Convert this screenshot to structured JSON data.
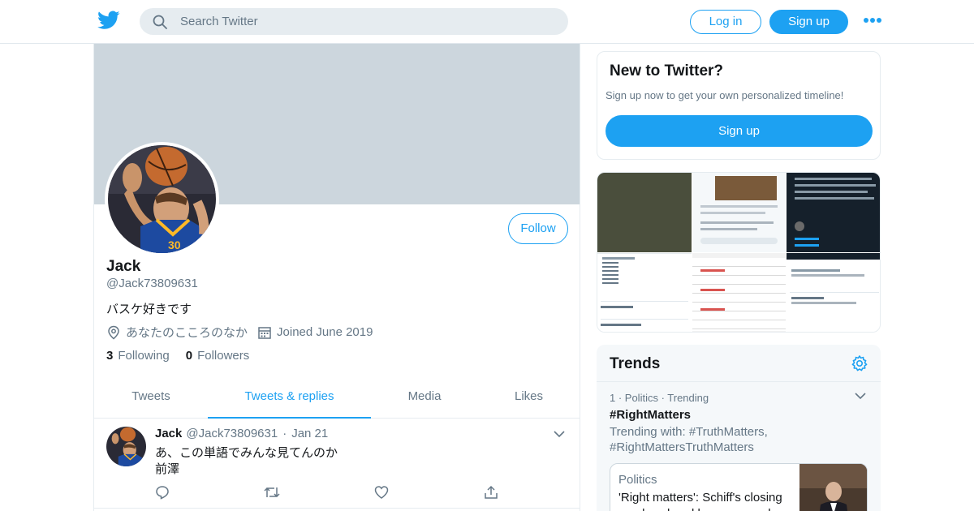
{
  "header": {
    "search_placeholder": "Search Twitter",
    "login_label": "Log in",
    "signup_label": "Sign up"
  },
  "profile": {
    "name": "Jack",
    "handle": "@Jack73809631",
    "bio": "バスケ好きです",
    "location": "あなたのこころのなか",
    "joined": "Joined June 2019",
    "following_count": "3",
    "following_label": "Following",
    "followers_count": "0",
    "followers_label": "Followers",
    "follow_label": "Follow"
  },
  "tabs": [
    {
      "label": "Tweets",
      "active": false
    },
    {
      "label": "Tweets & replies",
      "active": true
    },
    {
      "label": "Media",
      "active": false
    },
    {
      "label": "Likes",
      "active": false
    }
  ],
  "tweet": {
    "name": "Jack",
    "handle": "@Jack73809631",
    "date": "Jan 21",
    "line1": "あ、この単語でみんな見てんのか",
    "line2": "前澤"
  },
  "new_to_twitter": {
    "title": "New to Twitter?",
    "subtitle": "Sign up now to get your own personalized timeline!",
    "button": "Sign up"
  },
  "trends": {
    "title": "Trends",
    "items": [
      {
        "meta": "1 · Politics · Trending",
        "tag": "#RightMatters",
        "with": "Trending with: #TruthMatters, #RightMattersTruthMatters"
      }
    ],
    "news": {
      "category": "Politics",
      "headline": "'Right matters': Schiff's closing words echoed by many on da"
    }
  },
  "colors": {
    "accent": "#1da1f2",
    "banner": "#ccd6dd",
    "muted": "#657786"
  }
}
